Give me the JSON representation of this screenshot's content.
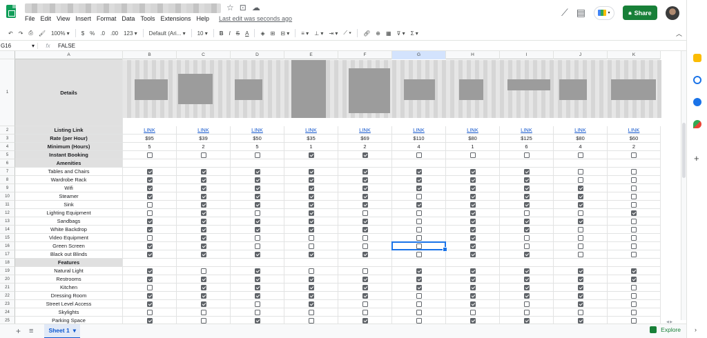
{
  "header": {
    "menu": [
      "File",
      "Edit",
      "View",
      "Insert",
      "Format",
      "Data",
      "Tools",
      "Extensions",
      "Help"
    ],
    "last_edit": "Last edit was seconds ago",
    "share_label": "Share"
  },
  "toolbar": {
    "zoom": "100%",
    "currency": "$",
    "percent": "%",
    "dec_decrease": ".0",
    "dec_increase": ".00",
    "number_format": "123",
    "font": "Default (Ari...",
    "font_size": "10",
    "bold": "B",
    "italic": "I",
    "strike": "S",
    "text_color": "A"
  },
  "formula_bar": {
    "cell_ref": "G16",
    "fx": "fx",
    "value": "FALSE"
  },
  "grid": {
    "columns": [
      "A",
      "B",
      "C",
      "D",
      "E",
      "F",
      "G",
      "H",
      "I",
      "J",
      "K"
    ],
    "selected_col": "G",
    "row_numbers": [
      "1",
      "2",
      "3",
      "4",
      "5",
      "6",
      "7",
      "8",
      "9",
      "10",
      "11",
      "12",
      "13",
      "14",
      "15",
      "16",
      "17",
      "18",
      "19",
      "20",
      "21",
      "22",
      "23",
      "24",
      "25"
    ],
    "details_label": "Details",
    "listing": {
      "label": "Listing Link",
      "values": [
        "LINK",
        "LINK",
        "LINK",
        "LINK",
        "LINK",
        "LINK",
        "LINK",
        "LINK",
        "LINK",
        "LINK"
      ]
    },
    "rate": {
      "label": "Rate (per Hour)",
      "values": [
        "$95",
        "$39",
        "$50",
        "$35",
        "$69",
        "$110",
        "$80",
        "$125",
        "$80",
        "$60"
      ]
    },
    "minimum": {
      "label": "Minimum (Hours)",
      "values": [
        "5",
        "2",
        "5",
        "1",
        "2",
        "4",
        "1",
        "6",
        "4",
        "2"
      ]
    },
    "instant": {
      "label": "Instant Booking",
      "values": [
        false,
        false,
        false,
        true,
        true,
        false,
        false,
        false,
        false,
        false
      ]
    },
    "amenities_label": "Amenities",
    "amenities": [
      {
        "label": "Tables and Chairs",
        "values": [
          true,
          true,
          true,
          true,
          true,
          true,
          true,
          true,
          false,
          false
        ]
      },
      {
        "label": "Wardrobe Rack",
        "values": [
          true,
          true,
          true,
          true,
          true,
          true,
          true,
          true,
          false,
          false
        ]
      },
      {
        "label": "Wifi",
        "values": [
          true,
          true,
          true,
          true,
          true,
          true,
          true,
          true,
          true,
          false
        ]
      },
      {
        "label": "Steamer",
        "values": [
          true,
          true,
          true,
          true,
          true,
          false,
          true,
          true,
          true,
          false
        ]
      },
      {
        "label": "Sink",
        "values": [
          false,
          true,
          true,
          true,
          true,
          true,
          true,
          true,
          true,
          false
        ]
      },
      {
        "label": "Lighting Equipment",
        "values": [
          false,
          true,
          false,
          true,
          false,
          false,
          true,
          false,
          false,
          true
        ]
      },
      {
        "label": "Sandbags",
        "values": [
          true,
          true,
          true,
          true,
          true,
          false,
          true,
          true,
          true,
          false
        ]
      },
      {
        "label": "White Backdrop",
        "values": [
          true,
          true,
          true,
          true,
          true,
          false,
          true,
          true,
          false,
          false
        ]
      },
      {
        "label": "Video Equipment",
        "values": [
          false,
          true,
          false,
          false,
          false,
          false,
          true,
          false,
          false,
          false
        ]
      },
      {
        "label": "Green Screen",
        "values": [
          true,
          true,
          false,
          false,
          false,
          false,
          true,
          false,
          false,
          false
        ]
      },
      {
        "label": "Black out Blinds",
        "values": [
          true,
          true,
          true,
          true,
          true,
          false,
          true,
          true,
          false,
          false
        ]
      }
    ],
    "features_label": "Features",
    "features": [
      {
        "label": "Natural Light",
        "values": [
          true,
          false,
          true,
          false,
          false,
          true,
          true,
          true,
          true,
          true
        ]
      },
      {
        "label": "Restrooms",
        "values": [
          true,
          true,
          true,
          true,
          true,
          true,
          true,
          true,
          true,
          true
        ]
      },
      {
        "label": "Kitchen",
        "values": [
          false,
          true,
          true,
          true,
          true,
          true,
          true,
          true,
          true,
          false
        ]
      },
      {
        "label": "Dressing Room",
        "values": [
          true,
          true,
          true,
          true,
          true,
          false,
          true,
          true,
          true,
          false
        ]
      },
      {
        "label": "Street Level Access",
        "values": [
          true,
          true,
          false,
          true,
          false,
          false,
          true,
          false,
          true,
          false
        ]
      },
      {
        "label": "Skylights",
        "values": [
          false,
          false,
          false,
          false,
          false,
          false,
          false,
          false,
          false,
          false
        ]
      },
      {
        "label": "Parking Space",
        "values": [
          true,
          false,
          true,
          false,
          true,
          false,
          true,
          true,
          true,
          false
        ]
      }
    ]
  },
  "bottom_bar": {
    "sheet_name": "Sheet 1",
    "explore": "Explore"
  }
}
